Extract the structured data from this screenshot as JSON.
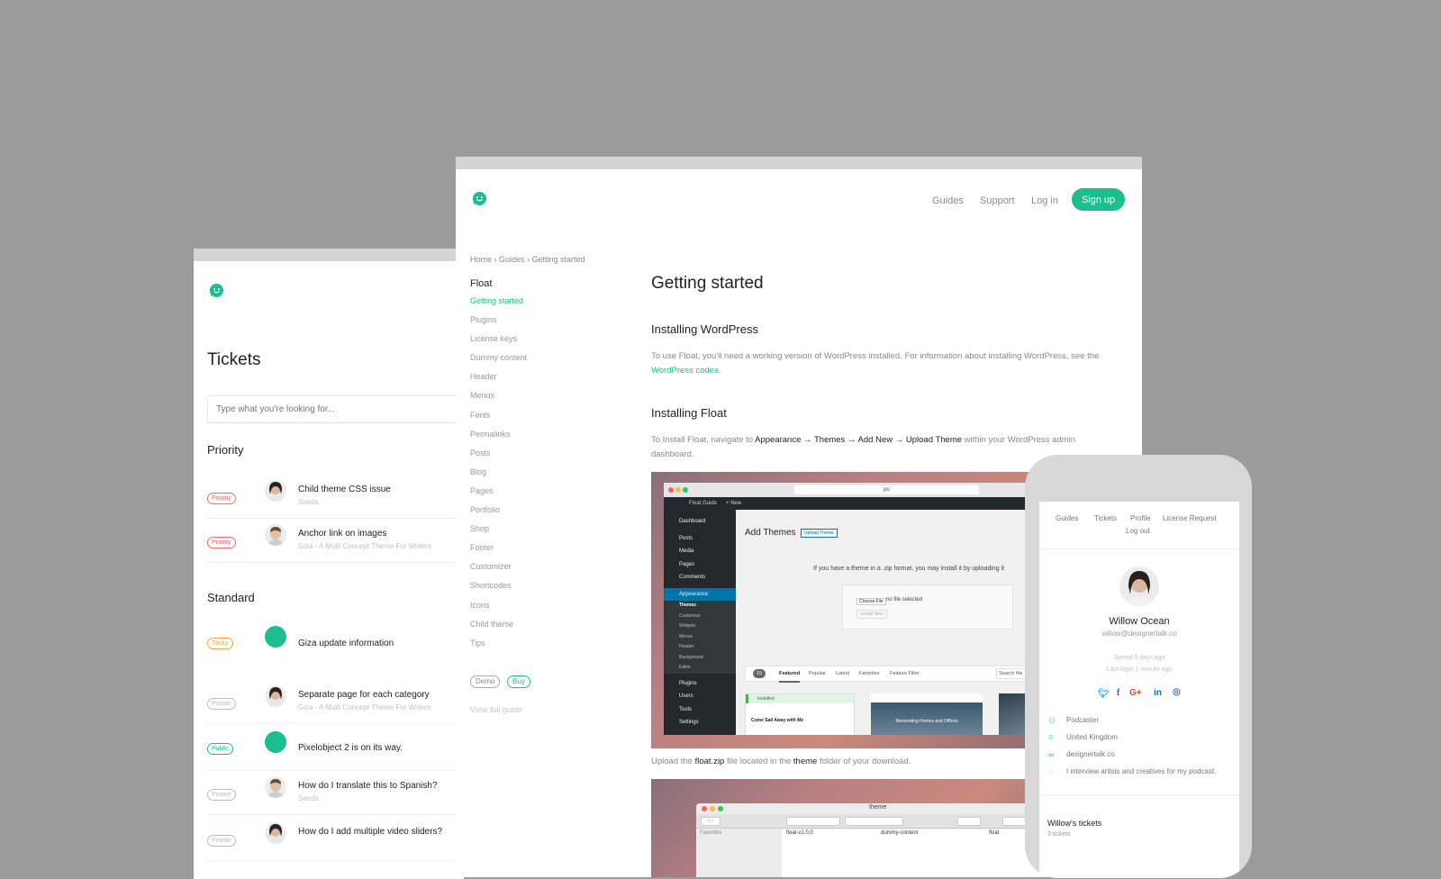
{
  "tickets": {
    "title": "Tickets",
    "search_placeholder": "Type what you're looking for...",
    "priority_heading": "Priority",
    "standard_heading": "Standard",
    "priority": [
      {
        "badge": "Priority",
        "title": "Child theme CSS issue",
        "sub": "Seeds"
      },
      {
        "badge": "Priority",
        "title": "Anchor link on images",
        "sub": "Giza - A Multi Concept Theme For Writers"
      }
    ],
    "standard": [
      {
        "badge": "Sticky",
        "title": "Giza update information",
        "sub": ""
      },
      {
        "badge": "Private",
        "title": "Separate page for each category",
        "sub": "Giza - A Multi Concept Theme For Writers"
      },
      {
        "badge": "Public",
        "title": "Pixelobject 2 is on its way.",
        "sub": ""
      },
      {
        "badge": "Private",
        "title": "How do I translate this to Spanish?",
        "sub": "Seeds"
      },
      {
        "badge": "Private",
        "title": "How do I add multiple video sliders?",
        "sub": ""
      }
    ],
    "badge_colors": {
      "Priority": "#e86a6a",
      "Sticky": "#f0a640",
      "Private": "#bdbdbd",
      "Public": "#1cbd8e"
    }
  },
  "docs": {
    "nav": {
      "guides": "Guides",
      "support": "Support",
      "login": "Log in",
      "signup": "Sign up"
    },
    "breadcrumb": "Home  ›  Guides  ›  Getting started",
    "sidebar": {
      "heading": "Float",
      "items": [
        "Getting started",
        "Plugins",
        "License keys",
        "Dummy content",
        "Header",
        "Menus",
        "Fonts",
        "Permalinks",
        "Posts",
        "Blog",
        "Pages",
        "Portfolio",
        "Shop",
        "Footer",
        "Customizer",
        "Shortcodes",
        "Icons",
        "Child theme",
        "Tips"
      ],
      "demo": "Demo",
      "buy": "Buy",
      "view_full_guide": "View full guide"
    },
    "title": "Getting started",
    "section1": {
      "heading": "Installing WordPress",
      "text": "To use Float, you'll need a working version of WordPress installed. For information about installing WordPress, see the",
      "link": "WordPress codex."
    },
    "section2": {
      "heading": "Installing Float",
      "text_a": "To Install Float, navigate to",
      "path": "Appearance → Themes → Add New → Upload Theme",
      "text_b": "within your WordPress admin dashboard."
    },
    "upload_text_a": "Upload the",
    "upload_file": "float.zip",
    "upload_text_b": "file located in the",
    "upload_folder": "theme",
    "upload_text_c": "folder of your download.",
    "screenshot1": {
      "url": "po",
      "admin_bar": "Float Guide",
      "admin_new": "+ New",
      "page_title": "Add Themes",
      "upload_btn": "Upload Theme",
      "info": "If you have a theme in a .zip format, you may install it by uploading it",
      "choose": "Choose File",
      "no_file": "no file selected",
      "install": "Install Now",
      "menu": [
        "Dashboard",
        "Posts",
        "Media",
        "Pages",
        "Comments",
        "Appearance",
        "Plugins",
        "Users",
        "Tools",
        "Settings"
      ],
      "submenu": [
        "Themes",
        "Customize",
        "Widgets",
        "Menus",
        "Header",
        "Background",
        "Editor"
      ],
      "tabs_count": "15",
      "tabs": [
        "Featured",
        "Popular",
        "Latest",
        "Favorites",
        "Feature Filter"
      ],
      "search": "Search the",
      "installed": "Installed",
      "card1": "Come Sail Away with Me",
      "card2": "Renovating Homes and Offices"
    },
    "screenshot2": {
      "folder": "theme",
      "favorites": "Favorites",
      "col1": "float-v1.0.0",
      "col2": "dummy-content",
      "col3": "float"
    }
  },
  "phone": {
    "nav": [
      "Guides",
      "Tickets",
      "Profile",
      "License Request",
      "Log out"
    ],
    "name": "Willow Ocean",
    "email": "willow@designertalk.co",
    "joined": "Joined 9 days ago",
    "last_login": "Last login 1 minute ago",
    "social": [
      "twitter-icon",
      "facebook-icon",
      "google-plus-icon",
      "linkedin-icon",
      "instagram-icon"
    ],
    "info": [
      "Podcaster",
      "United Kingdom",
      "designertalk.co",
      "I interview artists and creatives for my podcast."
    ],
    "tickets_heading": "Willow's tickets",
    "tickets_count": "3 tickets"
  },
  "colors": {
    "accent": "#1cbd8e",
    "background": "#9b9b9b"
  }
}
